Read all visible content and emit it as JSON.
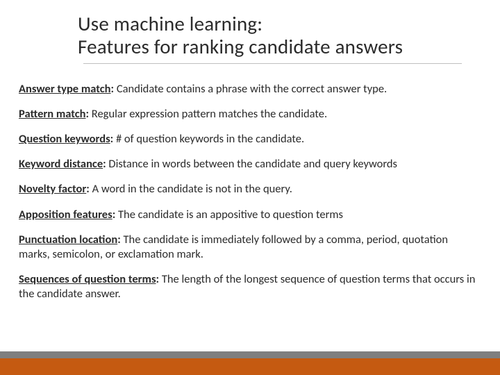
{
  "title": {
    "line1": "Use machine learning:",
    "line2": "Features for ranking candidate answers"
  },
  "features": [
    {
      "label": "Answer type match",
      "desc": "  Candidate contains a phrase with the correct answer type."
    },
    {
      "label": "Pattern match",
      "desc": " Regular expression pattern matches the candidate."
    },
    {
      "label": "Question keywords",
      "desc": " # of question keywords in the candidate."
    },
    {
      "label": "Keyword distance",
      "desc": " Distance in words between the candidate and query keywords"
    },
    {
      "label": "Novelty factor",
      "desc": " A word in the candidate is not in the query."
    },
    {
      "label": "Apposition features",
      "desc": " The candidate is an appositive to question terms"
    },
    {
      "label": "Punctuation location",
      "desc": " The candidate is immediately followed by a comma, period, quotation marks, semicolon, or exclamation mark."
    },
    {
      "label": "Sequences of question terms",
      "desc": " The length of the longest sequence of question terms that occurs in the candidate answer."
    }
  ]
}
